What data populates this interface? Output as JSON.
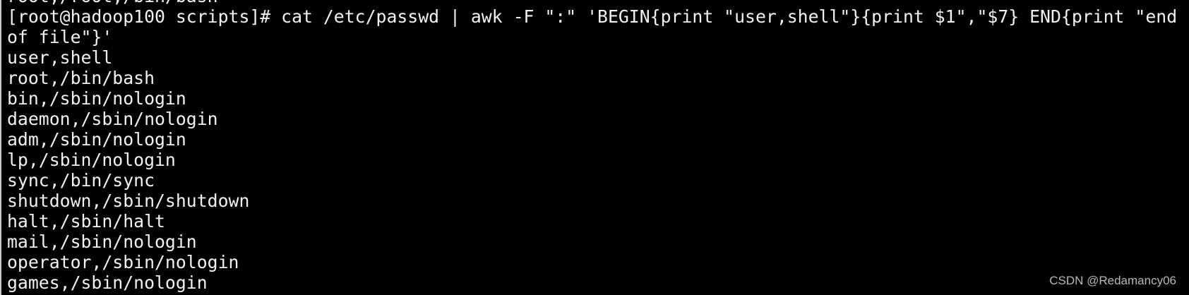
{
  "terminal": {
    "lines": [
      "root,/root,/bin/bash",
      "[root@hadoop100 scripts]# cat /etc/passwd | awk -F \":\" 'BEGIN{print \"user,shell\"}{print $1\",\"$7} END{print \"end",
      "of file\"}'",
      "user,shell",
      "root,/bin/bash",
      "bin,/sbin/nologin",
      "daemon,/sbin/nologin",
      "adm,/sbin/nologin",
      "lp,/sbin/nologin",
      "sync,/bin/sync",
      "shutdown,/sbin/shutdown",
      "halt,/sbin/halt",
      "mail,/sbin/nologin",
      "operator,/sbin/nologin",
      "games,/sbin/nologin"
    ]
  },
  "watermark": "CSDN @Redamancy06",
  "colors": {
    "background": "#000000",
    "text": "#f2f2f2"
  }
}
